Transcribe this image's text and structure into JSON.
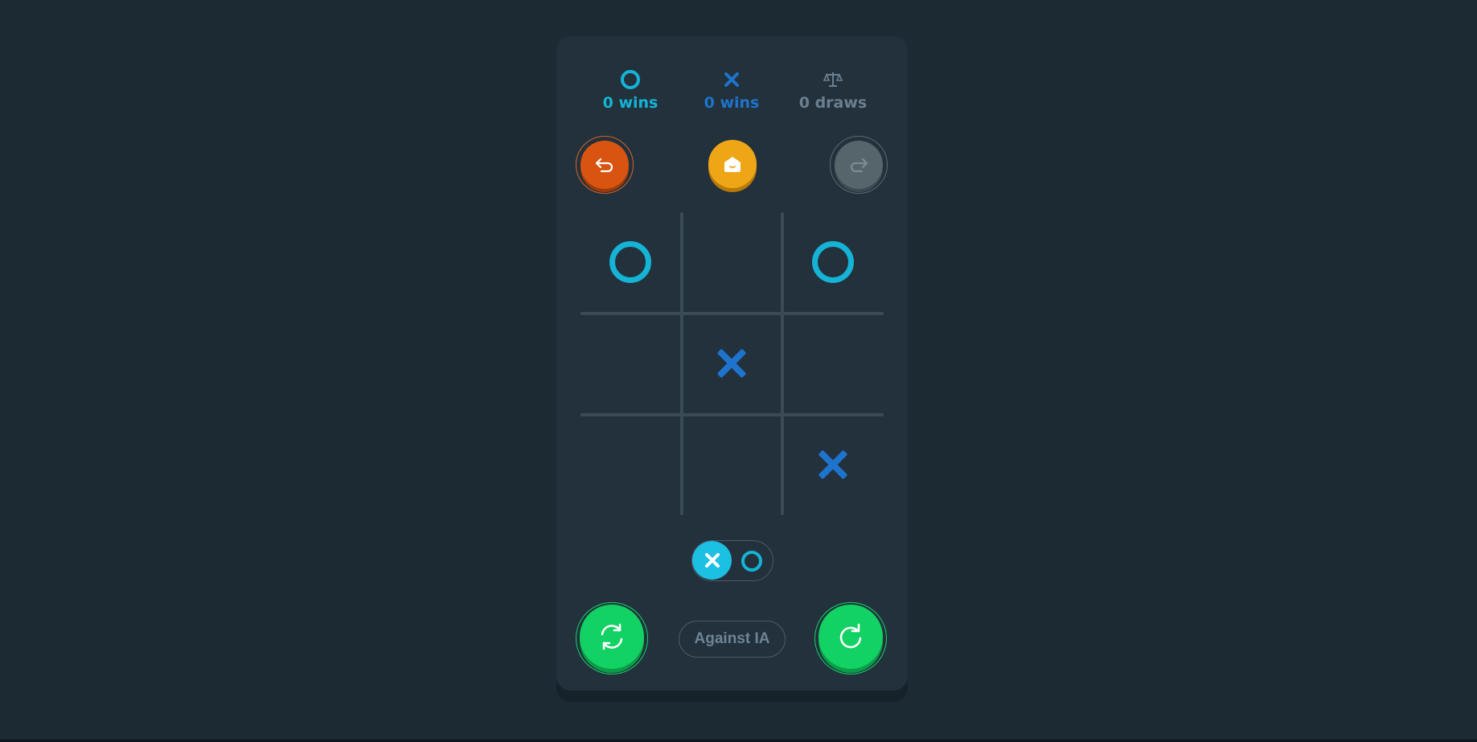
{
  "scoreboard": {
    "o": {
      "label": "0 wins",
      "icon": "circle-icon",
      "color": "#15b3d6"
    },
    "x": {
      "label": "0 wins",
      "icon": "cross-icon",
      "color": "#1e74cc"
    },
    "draws": {
      "label": "0 draws",
      "icon": "scale-icon",
      "color": "#6a7f8f"
    }
  },
  "controls": {
    "undo": {
      "icon": "undo-icon",
      "color": "#d85410"
    },
    "home": {
      "icon": "home-icon",
      "color": "#eea617"
    },
    "redo": {
      "icon": "redo-icon",
      "color": "#56646c",
      "disabled": true
    }
  },
  "board": {
    "cells": [
      "O",
      "",
      "O",
      "",
      "X",
      "",
      "",
      "",
      "X"
    ]
  },
  "side_toggle": {
    "options": [
      "X",
      "O"
    ],
    "selected": "X"
  },
  "bottom": {
    "swap_icon": "swap-icon",
    "mode_label": "Against IA",
    "restart_icon": "restart-icon",
    "accent": "#11d263"
  }
}
